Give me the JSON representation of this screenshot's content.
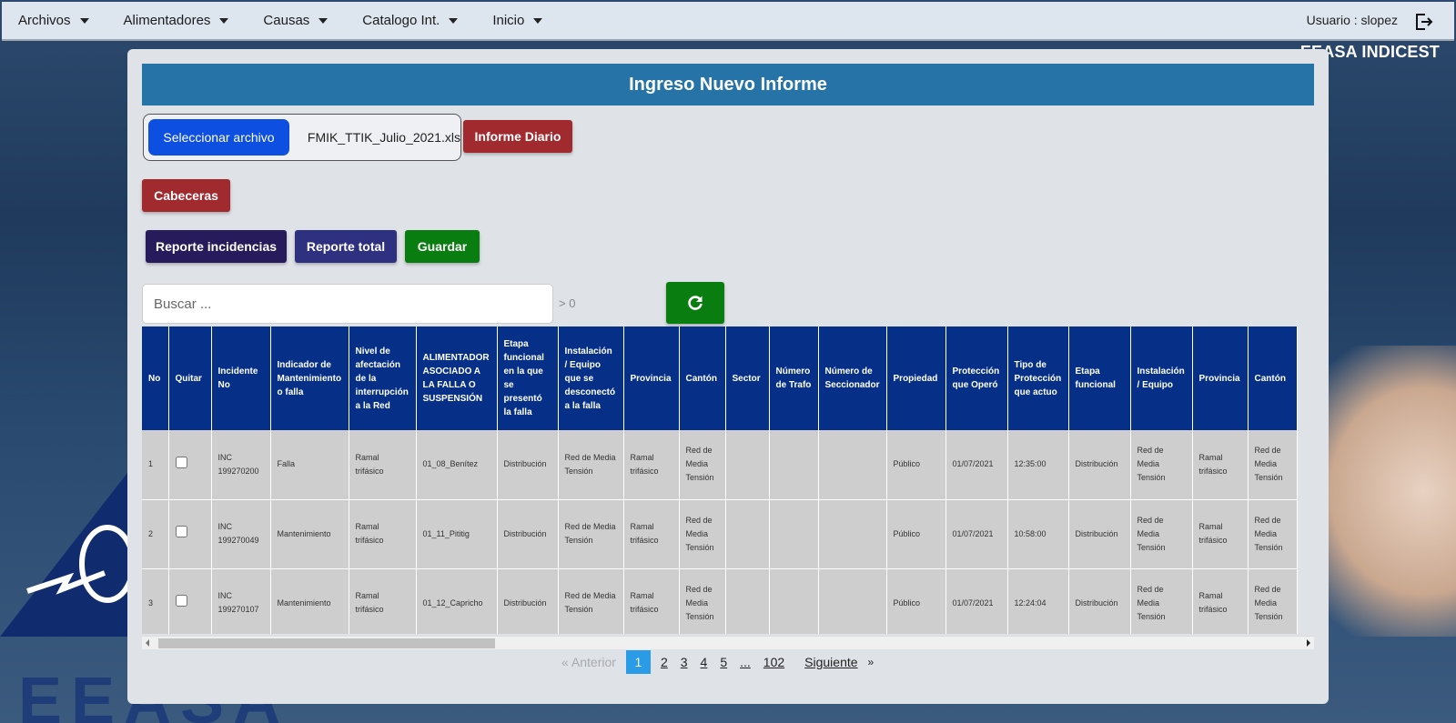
{
  "nav": {
    "items": [
      "Archivos",
      "Alimentadores",
      "Causas",
      "Catalogo Int.",
      "Inicio"
    ],
    "user": "Usuario : slopez",
    "brand": "EEASA INDICEST"
  },
  "background": {
    "logo_text": "EEASA"
  },
  "panel": {
    "title": "Ingreso Nuevo Informe",
    "file": {
      "button": "Seleccionar archivo",
      "name": "FMIK_TTIK_Julio_2021.xls"
    },
    "buttons": {
      "informe_diario": "Informe Diario",
      "cabeceras": "Cabeceras",
      "reporte_incidencias": "Reporte incidencias",
      "reporte_total": "Reporte total",
      "guardar": "Guardar"
    },
    "search": {
      "placeholder": "Buscar ...",
      "count": "> 0"
    }
  },
  "table": {
    "headers": [
      "No",
      "Quitar",
      "Incidente No",
      "Indicador de Mantenimiento o falla",
      "Nivel de afectación de la interrupción a la Red",
      "ALIMENTADOR ASOCIADO A LA FALLA O SUSPENSIÓN",
      "Etapa funcional en la que se presentó la falla",
      "Instalación / Equipo que se desconectó a la falla",
      "Provincia",
      "Cantón",
      "Sector",
      "Número de Trafo",
      "Número de Seccionador",
      "Propiedad",
      "Protección que Operó",
      "Tipo de Protección que actuo",
      "Etapa funcional",
      "Instalación / Equipo",
      "Provincia",
      "Cantón"
    ],
    "rows": [
      [
        "1",
        "",
        "INC 199270200",
        "Falla",
        "Ramal trifásico",
        "01_08_Benítez",
        "Distribución",
        "Red de Media Tensión",
        "Ramal trifásico",
        "Red de Media Tensión",
        "",
        "",
        "",
        "Público",
        "01/07/2021",
        "12:35:00",
        "Distribución",
        "Red de Media Tensión",
        "Ramal trifásico",
        "Red de Media Tensión"
      ],
      [
        "2",
        "",
        "INC 199270049",
        "Mantenimiento",
        "Ramal trifásico",
        "01_11_Pititig",
        "Distribución",
        "Red de Media Tensión",
        "Ramal trifásico",
        "Red de Media Tensión",
        "",
        "",
        "",
        "Público",
        "01/07/2021",
        "10:58:00",
        "Distribución",
        "Red de Media Tensión",
        "Ramal trifásico",
        "Red de Media Tensión"
      ],
      [
        "3",
        "",
        "INC 199270107",
        "Mantenimiento",
        "Ramal trifásico",
        "01_12_Capricho",
        "Distribución",
        "Red de Media Tensión",
        "Ramal trifásico",
        "Red de Media Tensión",
        "",
        "",
        "",
        "Público",
        "01/07/2021",
        "12:24:04",
        "Distribución",
        "Red de Media Tensión",
        "Ramal trifásico",
        "Red de Media Tensión"
      ]
    ]
  },
  "pagination": {
    "prev": "« Anterior",
    "pages": [
      "1",
      "2",
      "3",
      "4",
      "5",
      "...",
      "102"
    ],
    "active": "1",
    "next": "Siguiente",
    "next_arrow": "»"
  },
  "colors": {
    "header_bg": "#063088",
    "title_bg": "#2673a8",
    "active_page": "#2a9be6"
  }
}
